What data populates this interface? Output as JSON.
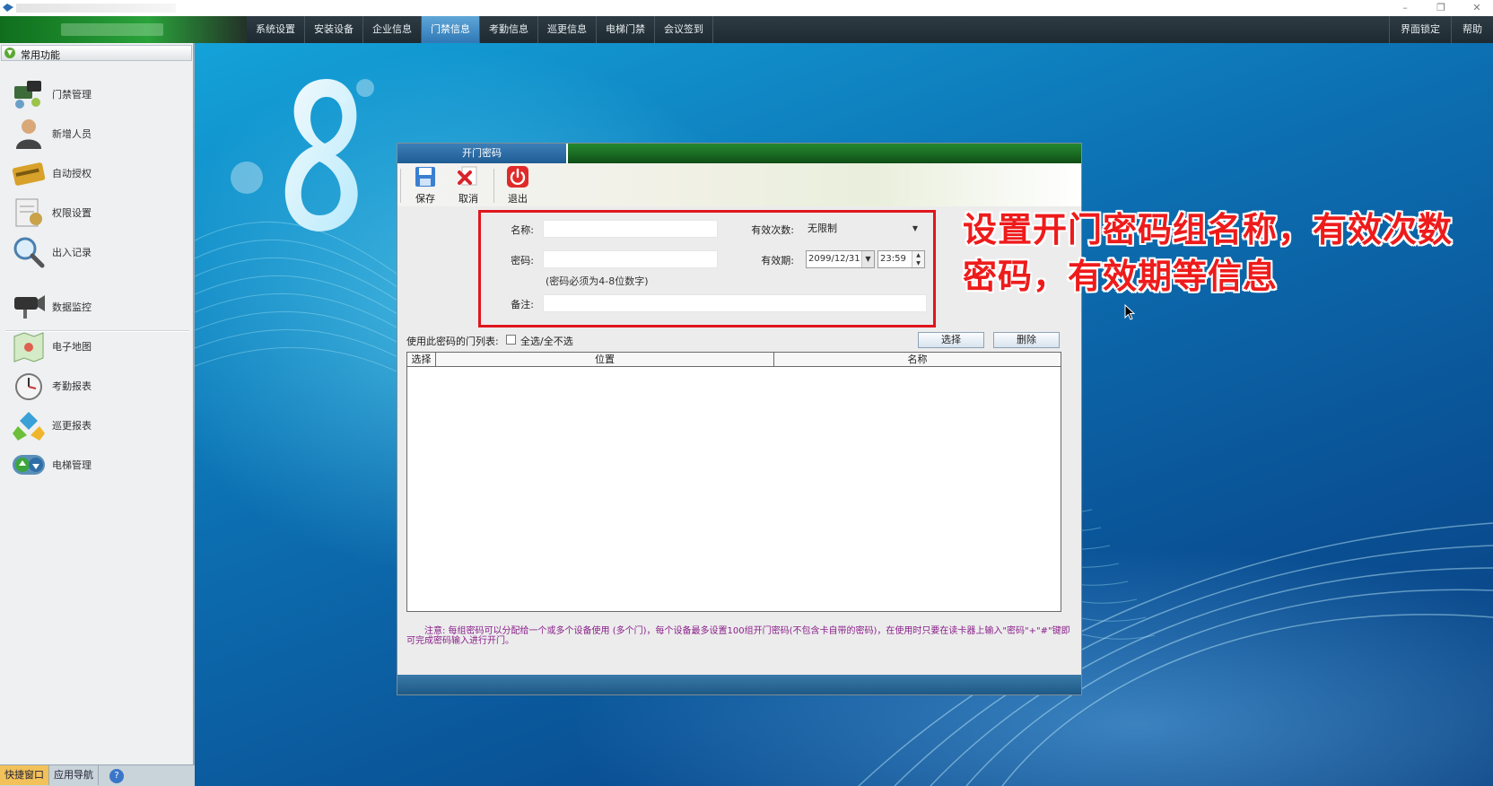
{
  "window": {
    "minimize": "–",
    "restore": "❐",
    "close": "✕"
  },
  "menu": {
    "items": [
      "系统设置",
      "安装设备",
      "企业信息",
      "门禁信息",
      "考勤信息",
      "巡更信息",
      "电梯门禁",
      "会议签到"
    ],
    "active": "门禁信息",
    "right": [
      "界面锁定",
      "帮助"
    ]
  },
  "sidebar": {
    "header": "常用功能",
    "items": [
      {
        "label": "门禁管理",
        "icon": "door-access-icon"
      },
      {
        "label": "新增人员",
        "icon": "person-icon"
      },
      {
        "label": "自动授权",
        "icon": "card-icon"
      },
      {
        "label": "权限设置",
        "icon": "permission-icon"
      },
      {
        "label": "出入记录",
        "icon": "magnifier-icon"
      },
      {
        "label": "数据监控",
        "icon": "camera-icon"
      },
      {
        "label": "电子地图",
        "icon": "map-icon"
      },
      {
        "label": "考勤报表",
        "icon": "clock-icon"
      },
      {
        "label": "巡更报表",
        "icon": "patrol-icon"
      },
      {
        "label": "电梯管理",
        "icon": "elevator-icon"
      }
    ],
    "bottom_tabs": [
      "快捷窗口",
      "应用导航"
    ],
    "help": "?"
  },
  "dialog": {
    "tab_title": "开门密码",
    "toolbar": {
      "save": "保存",
      "cancel": "取消",
      "exit": "退出"
    },
    "form": {
      "name_label": "名称:",
      "name_value": "",
      "count_label": "有效次数:",
      "count_value": "无限制",
      "password_label": "密码:",
      "password_value": "",
      "password_hint": "(密码必须为4-8位数字)",
      "expiry_label": "有效期:",
      "expiry_date": "2099/12/31",
      "expiry_time": "23:59",
      "remark_label": "备注:",
      "remark_value": ""
    },
    "doors": {
      "label": "使用此密码的门列表:",
      "select_all": "全选/全不选",
      "select_button": "选择",
      "delete_button": "删除",
      "columns": [
        "选择",
        "位置",
        "名称"
      ],
      "rows": []
    },
    "note": "注意: 每组密码可以分配给一个或多个设备使用 (多个门)，每个设备最多设置100组开门密码(不包含卡自带的密码)，在使用时只要在读卡器上输入\"密码\"+\"#\"键即可完成密码输入进行开门。"
  },
  "annotation": {
    "line1": "设置开门密码组名称，有效次数",
    "line2": "密码，有效期等信息"
  },
  "colors": {
    "highlight_box": "#e0161e",
    "annotation_text": "#ee1b1b",
    "note_text": "#8a1f8a",
    "active_menu": "#2f78b5"
  }
}
